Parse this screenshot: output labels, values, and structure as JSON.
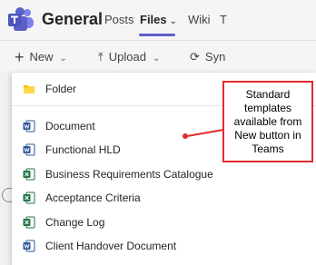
{
  "header": {
    "channel_name": "General",
    "tabs": [
      {
        "label": "Posts"
      },
      {
        "label": "Files",
        "active": true
      },
      {
        "label": "Wiki"
      },
      {
        "label": "T"
      }
    ]
  },
  "toolbar": {
    "new_label": "New",
    "upload_label": "Upload",
    "sync_label": "Syn"
  },
  "new_menu": {
    "items": [
      {
        "label": "Folder",
        "icon": "folder-icon"
      },
      {
        "label": "Document",
        "icon": "word-icon"
      },
      {
        "label": "Functional HLD",
        "icon": "word-icon"
      },
      {
        "label": "Business Requirements Catalogue",
        "icon": "excel-icon"
      },
      {
        "label": "Acceptance Criteria",
        "icon": "excel-icon"
      },
      {
        "label": "Change Log",
        "icon": "excel-icon"
      },
      {
        "label": "Client Handover Document",
        "icon": "word-icon"
      }
    ]
  },
  "callout": {
    "lines": [
      "Standard",
      "templates",
      "available from",
      "New button in",
      "Teams"
    ]
  },
  "colors": {
    "teams_purple": "#5b5fc7",
    "callout_red": "#e02b2b",
    "word_blue": "#2b579a",
    "excel_green": "#217346",
    "folder_yellow": "#f5c400"
  }
}
